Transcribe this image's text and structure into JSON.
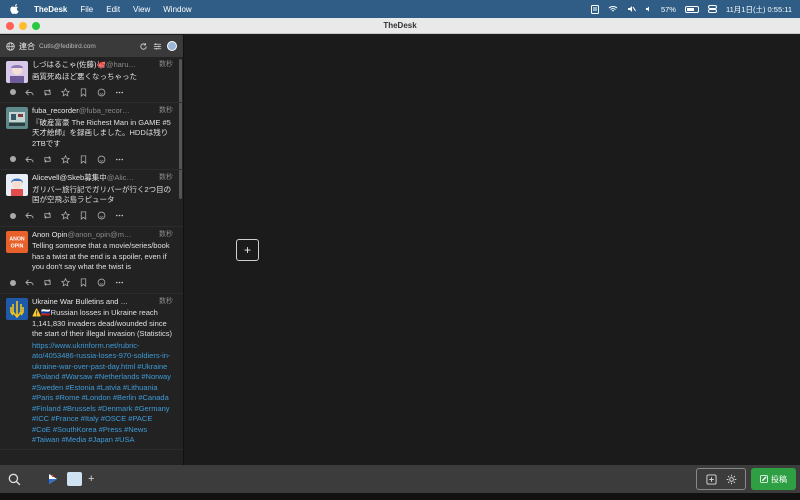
{
  "menubar": {
    "app_name": "TheDesk",
    "menus": [
      "File",
      "Edit",
      "View",
      "Window"
    ],
    "battery": "57%",
    "datetime": "11月1日(土) 0:55:11"
  },
  "window": {
    "title": "TheDesk"
  },
  "column": {
    "title": "連合",
    "account": "Cutls@fedibird.com"
  },
  "toots": [
    {
      "name": "しづはるこゃ(佐藤)🐙",
      "handle": "@haru…",
      "time": "数秒",
      "text": "画質死ぬほど悪くなっちゃった",
      "links": ""
    },
    {
      "name": "fuba_recorder",
      "handle": "@fuba_recor…",
      "time": "数秒",
      "text": "『破産富豪 The Richest Man in GAME #5 天才絵師』を録画しました。HDDは残り2TBです",
      "links": ""
    },
    {
      "name": "Alicevell@Skeb募集中",
      "handle": "@Alic…",
      "time": "数秒",
      "text": "ガリバー旅行記でガリバーが行く2つ目の国が空飛ぶ島ラピュータ",
      "links": ""
    },
    {
      "name": "Anon Opin",
      "handle": "@anon_opin@m…",
      "time": "数秒",
      "text": "Telling someone that a movie/series/book has a twist at the end is a spoiler, even if you don't say what the twist is",
      "links": ""
    },
    {
      "name": "Ukraine War Bulletins and …",
      "handle": "",
      "time": "数秒",
      "text": "⚠️🇷🇺Russian losses in Ukraine reach 1,141,830 invaders dead/wounded since the start of their illegal invasion (Statistics)",
      "links": "https://www.ukrinform.net/rubric-ato/4053486-russia-loses-970-soldiers-in-ukraine-war-over-past-day.html #Ukraine #Poland #Warsaw #Netherlands #Norway #Sweden #Estonia #Latvia #Lithuania #Paris #Rome #London #Berlin #Canada #Finland #Brussels #Denmark #Germany #ICC #France #Italy #OSCE #PACE #CoE #SouthKorea #Press #News #Taiwan #Media #Japan #USA"
    }
  ],
  "avatars": {
    "anon_opin_label": "ANON OPIN"
  },
  "bottombar": {
    "add_label": "+",
    "toot_label": "投稿"
  },
  "add_column_label": "+",
  "colors": {
    "menubar": "#2f5d86",
    "accent_green": "#2ea043",
    "link": "#3e9bd8"
  }
}
